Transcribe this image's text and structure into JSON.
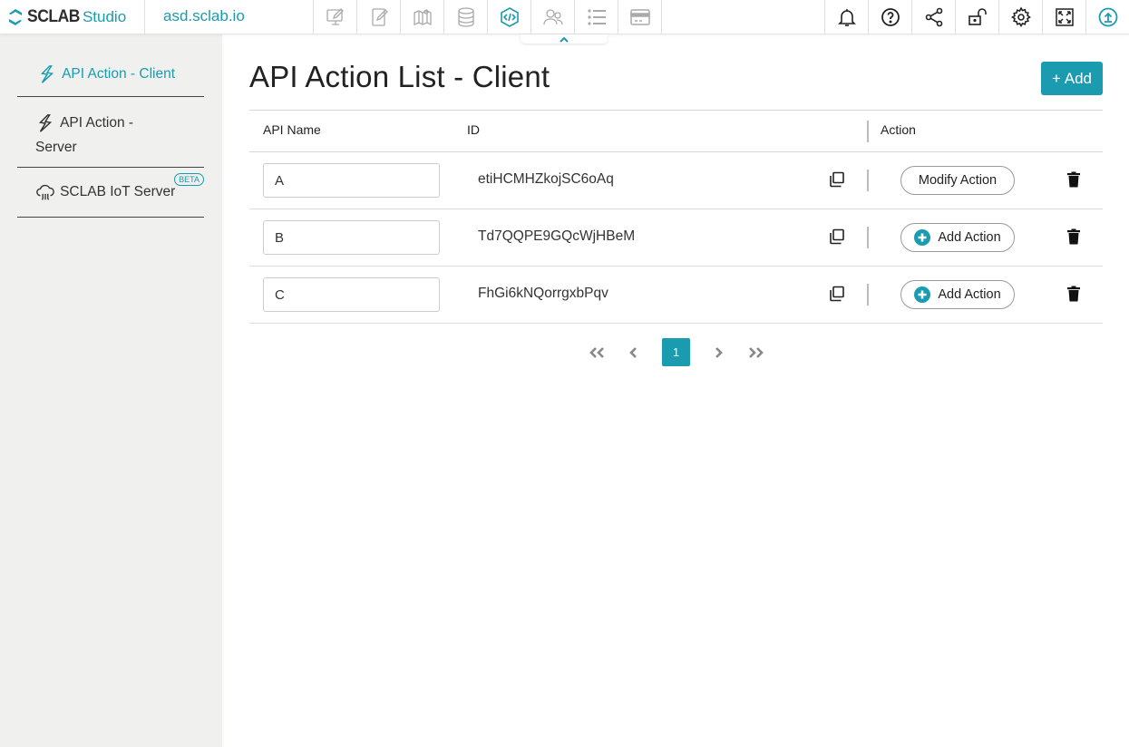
{
  "app": {
    "logo_primary": "SCLAB",
    "logo_secondary": "Studio",
    "domain": "asd.sclab.io"
  },
  "toolbar": {
    "left_tools": [
      {
        "name": "desktop-edit-icon",
        "active": false
      },
      {
        "name": "mobile-edit-icon",
        "active": false
      },
      {
        "name": "map-icon",
        "active": false
      },
      {
        "name": "database-icon",
        "active": false
      },
      {
        "name": "api-code-icon",
        "active": true
      },
      {
        "name": "users-icon",
        "active": false
      },
      {
        "name": "list-icon",
        "active": false
      },
      {
        "name": "card-icon",
        "active": false
      }
    ],
    "right_tools": [
      {
        "name": "bell-icon"
      },
      {
        "name": "help-icon"
      },
      {
        "name": "share-icon"
      },
      {
        "name": "unlock-icon"
      },
      {
        "name": "settings-icon"
      },
      {
        "name": "fullscreen-icon"
      },
      {
        "name": "upload-icon"
      }
    ],
    "accent_color": "#1a9bb0"
  },
  "sidebar": {
    "items": [
      {
        "label": "API Action - Client",
        "icon": "lightning-icon",
        "active": true
      },
      {
        "label": "API Action - Server",
        "icon": "lightning-icon",
        "active": false
      },
      {
        "label": "SCLAB IoT Server",
        "icon": "cloud-iot-icon",
        "active": false,
        "badge": "BETA"
      }
    ]
  },
  "main": {
    "title": "API Action List - Client",
    "add_button": "+ Add",
    "columns": [
      "API Name",
      "ID",
      "Action"
    ],
    "rows": [
      {
        "name": "A",
        "id": "etiHCMHZkojSC6oAq",
        "action": "Modify Action",
        "action_has_plus": false
      },
      {
        "name": "B",
        "id": "Td7QQPE9GQcWjHBeM",
        "action": "Add Action",
        "action_has_plus": true
      },
      {
        "name": "C",
        "id": "FhGi6kNQorrgxbPqv",
        "action": "Add Action",
        "action_has_plus": true
      }
    ],
    "pagination": {
      "current": "1"
    }
  }
}
